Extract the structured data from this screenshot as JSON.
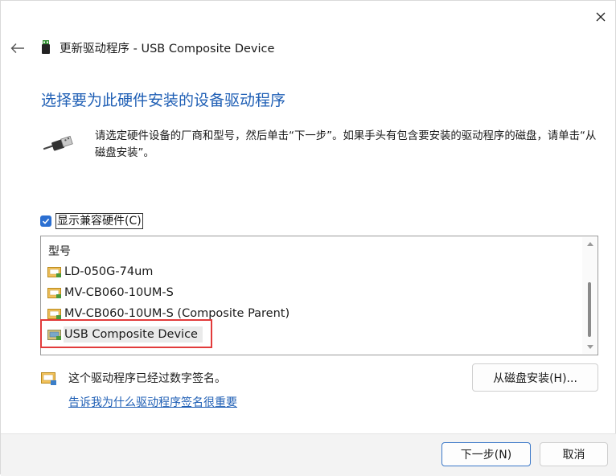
{
  "window": {
    "title": "更新驱动程序 - USB Composite Device",
    "close_glyph": "✕",
    "back_glyph": "←"
  },
  "heading": "选择要为此硬件安装的设备驱动程序",
  "description": "请选定硬件设备的厂商和型号，然后单击“下一步”。如果手头有包含要安装的驱动程序的磁盘，请单击“从磁盘安装”。",
  "compatible_checkbox": {
    "label": "显示兼容硬件(C)",
    "checked": true
  },
  "model_list": {
    "header": "型号",
    "items": [
      {
        "label": "LD-050G-74um",
        "icon": "driver-icon"
      },
      {
        "label": "MV-CB060-10UM-S",
        "icon": "driver-icon"
      },
      {
        "label": "MV-CB060-10UM-S (Composite Parent)",
        "icon": "driver-icon"
      },
      {
        "label": "USB Composite Device",
        "icon": "driver-icon",
        "selected": true
      }
    ]
  },
  "signature": {
    "text": "这个驱动程序已经过数字签名。",
    "link": "告诉我为什么驱动程序签名很重要"
  },
  "buttons": {
    "have_disk": "从磁盘安装(H)...",
    "next": "下一步(N)",
    "cancel": "取消"
  },
  "colors": {
    "accent": "#1f5fb5",
    "highlight_box": "#e23b3b",
    "checkbox": "#2b6fd1"
  }
}
